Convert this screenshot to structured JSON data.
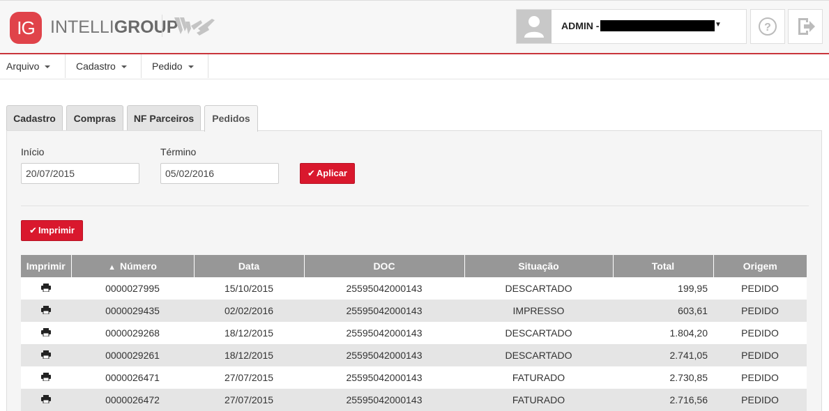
{
  "header": {
    "logo_badge": "IG",
    "logo_text_light": "INTELLI",
    "logo_text_bold": "GROUP",
    "secondary_logo": "ws",
    "user_label": "ADMIN -",
    "avatar_icon": "user-avatar-icon",
    "help_icon": "question-circle-icon",
    "exit_icon": "sign-out-icon",
    "accent_color": "#c9343b"
  },
  "menu": [
    {
      "label": "Arquivo"
    },
    {
      "label": "Cadastro"
    },
    {
      "label": "Pedido"
    }
  ],
  "tabs": [
    {
      "label": "Cadastro",
      "active": false
    },
    {
      "label": "Compras",
      "active": false
    },
    {
      "label": "NF Parceiros",
      "active": false
    },
    {
      "label": "Pedidos",
      "active": true
    }
  ],
  "filters": {
    "start_label": "Início",
    "start_value": "20/07/2015",
    "end_label": "Término",
    "end_value": "05/02/2016",
    "apply_label": "Aplicar"
  },
  "print_button_label": "Imprimir",
  "button_color": "#d9182d",
  "table": {
    "columns": [
      "Imprimir",
      "Número",
      "Data",
      "DOC",
      "Situação",
      "Total",
      "Origem"
    ],
    "sort_column": "Número",
    "sort_direction": "asc",
    "rows": [
      {
        "numero": "0000027995",
        "data": "15/10/2015",
        "doc": "25595042000143",
        "situacao": "DESCARTADO",
        "total": "199,95",
        "origem": "PEDIDO"
      },
      {
        "numero": "0000029435",
        "data": "02/02/2016",
        "doc": "25595042000143",
        "situacao": "IMPRESSO",
        "total": "603,61",
        "origem": "PEDIDO"
      },
      {
        "numero": "0000029268",
        "data": "18/12/2015",
        "doc": "25595042000143",
        "situacao": "DESCARTADO",
        "total": "1.804,20",
        "origem": "PEDIDO"
      },
      {
        "numero": "0000029261",
        "data": "18/12/2015",
        "doc": "25595042000143",
        "situacao": "DESCARTADO",
        "total": "2.741,05",
        "origem": "PEDIDO"
      },
      {
        "numero": "0000026471",
        "data": "27/07/2015",
        "doc": "25595042000143",
        "situacao": "FATURADO",
        "total": "2.730,85",
        "origem": "PEDIDO"
      },
      {
        "numero": "0000026472",
        "data": "27/07/2015",
        "doc": "25595042000143",
        "situacao": "FATURADO",
        "total": "2.716,56",
        "origem": "PEDIDO"
      }
    ]
  }
}
